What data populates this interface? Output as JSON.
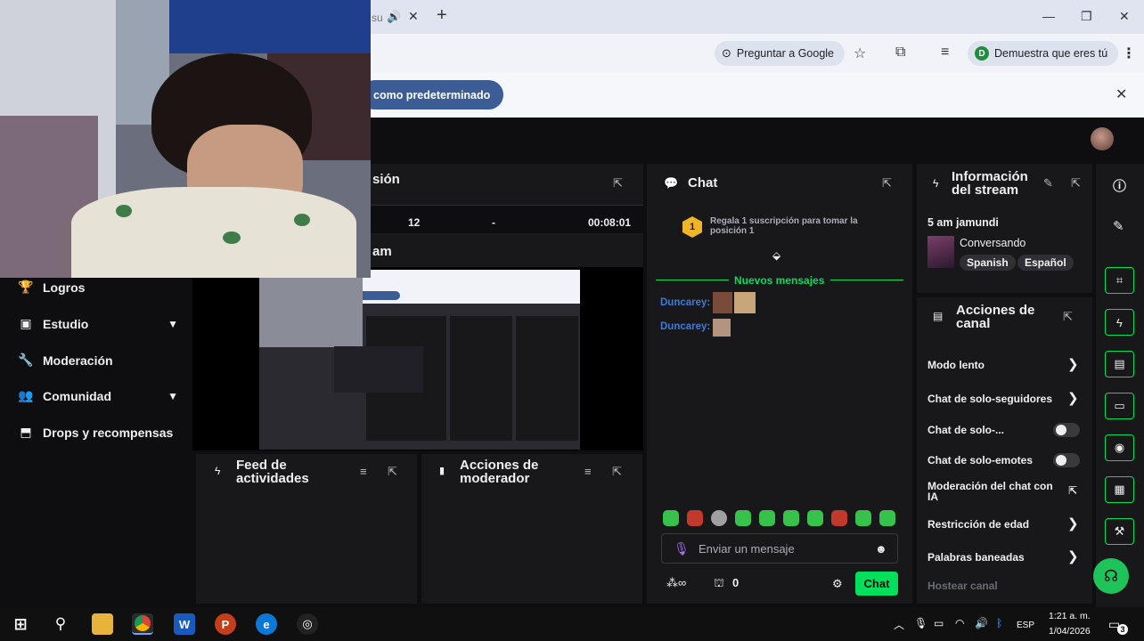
{
  "browser": {
    "tab_title": "su",
    "google_button": "Preguntar a Google",
    "profile_button": "Demuestra que eres tú",
    "profile_initial": "D",
    "default_prompt_button": "como predeterminado"
  },
  "sidebar": {
    "items": [
      {
        "label": "Logros"
      },
      {
        "label": "Estudio"
      },
      {
        "label": "Moderación"
      },
      {
        "label": "Comunidad"
      },
      {
        "label": "Drops y recompensas"
      }
    ]
  },
  "session": {
    "title": "sión",
    "stat1": "12",
    "stat2": "-",
    "uptime": "00:08:01",
    "preview_title": "am"
  },
  "activity_feed": {
    "title": "Feed de actividades"
  },
  "mod_actions": {
    "title": "Acciones de moderador"
  },
  "chat": {
    "title": "Chat",
    "gift_rank": "1",
    "gift_text": "Regala 1 suscripción para tomar la posición 1",
    "new_messages": "Nuevos mensajes",
    "messages": [
      {
        "user": "Duncarey:"
      },
      {
        "user": "Duncarey:"
      }
    ],
    "input_placeholder": "Enviar un mensaje",
    "points": "0",
    "send_button": "Chat"
  },
  "stream_info": {
    "title": "Información del stream",
    "stream_title": "5 am jamundi",
    "category": "Conversando",
    "tags": [
      "Spanish",
      "Español"
    ]
  },
  "channel_actions": {
    "title": "Acciones de canal",
    "items": [
      {
        "label": "Modo lento",
        "control": "arrow"
      },
      {
        "label": "Chat de solo-seguidores",
        "control": "arrow"
      },
      {
        "label": "Chat de solo-...",
        "control": "toggle"
      },
      {
        "label": "Chat de solo-emotes",
        "control": "toggle"
      },
      {
        "label": "Moderación del chat con IA",
        "control": "popout"
      },
      {
        "label": "Restricción de edad",
        "control": "arrow"
      },
      {
        "label": "Palabras baneadas",
        "control": "arrow"
      },
      {
        "label": "Hostear canal",
        "control": "none"
      }
    ]
  },
  "taskbar": {
    "language": "ESP",
    "time": "1:21 a. m.",
    "date": "1/04/2026",
    "notifications": "3"
  },
  "colors": {
    "accent": "#00e05c",
    "panel": "#18181b",
    "background": "#0e0e10",
    "username": "#3b7bd9",
    "badge": "#f0b428"
  }
}
